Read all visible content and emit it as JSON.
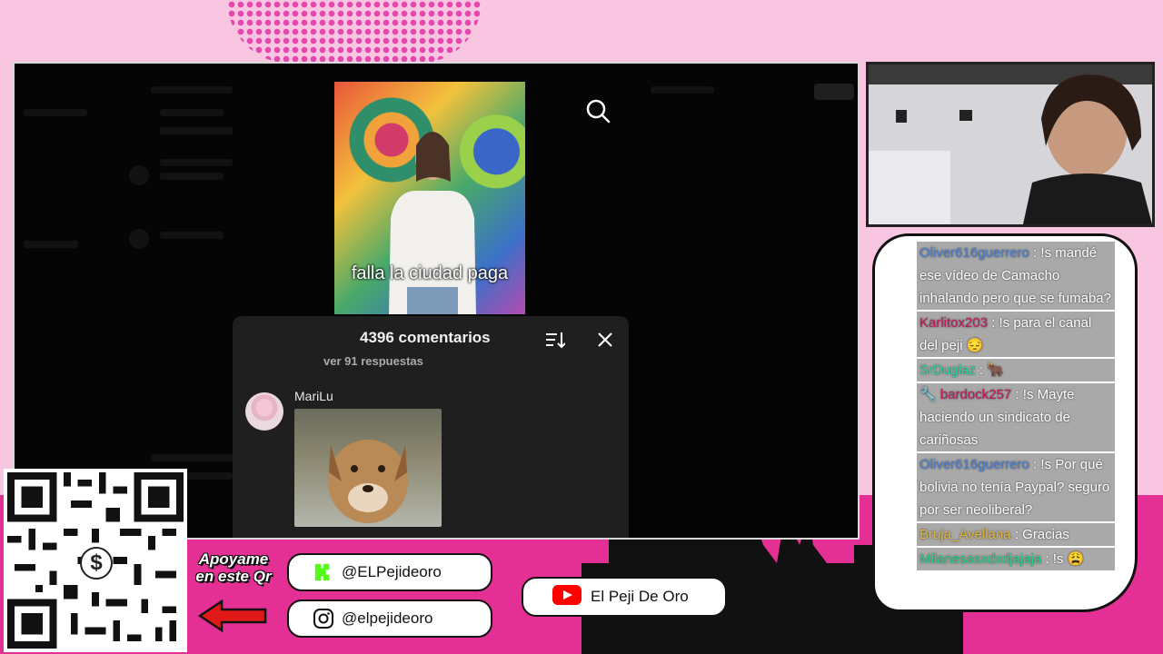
{
  "video": {
    "caption": "falla la ciudad paga"
  },
  "comments": {
    "title": "4396 comentarios",
    "replies_link": "ver 91 respuestas",
    "items": [
      {
        "author": "MariLu"
      }
    ]
  },
  "chat": {
    "messages": [
      {
        "user": "Oliver616guerrero",
        "user_color": "#4a7fd6",
        "text": ": !s mandé ese vídeo de Camacho inhalando pero que se fumaba?"
      },
      {
        "user": "Karlitox203",
        "user_color": "#c2185b",
        "text": ": !s para el canal del peji 😔"
      },
      {
        "user": "SrDuglaz",
        "user_color": "#2bd4a2",
        "text": ": 🐂"
      },
      {
        "user": "bardock257",
        "user_color": "#c2185b",
        "badge": "🔧",
        "text": ": !s Mayte haciendo un sindicato de cariñosas"
      },
      {
        "user": "Oliver616guerrero",
        "user_color": "#4a7fd6",
        "text": ": !s Por qué bolivia no tenía Paypal? seguro por ser neoliberal?"
      },
      {
        "user": "Bruja_Avellana",
        "user_color": "#e0b43a",
        "text": ": Gracias"
      },
      {
        "user": "Milanesasxdxdjajaja",
        "user_color": "#29d08a",
        "text": ": !s 😩"
      }
    ]
  },
  "promo": {
    "support_text": "Apoyame en este Qr",
    "kick_handle": "@ELPejideoro",
    "instagram_handle": "@elpejideoro",
    "youtube_channel": "El Peji De Oro"
  },
  "colors": {
    "background": "#f9c6e2",
    "band": "#e42f94",
    "chat_bubble": "#a9a9a9",
    "kick_green": "#53fc18",
    "youtube_red": "#ff0000"
  }
}
